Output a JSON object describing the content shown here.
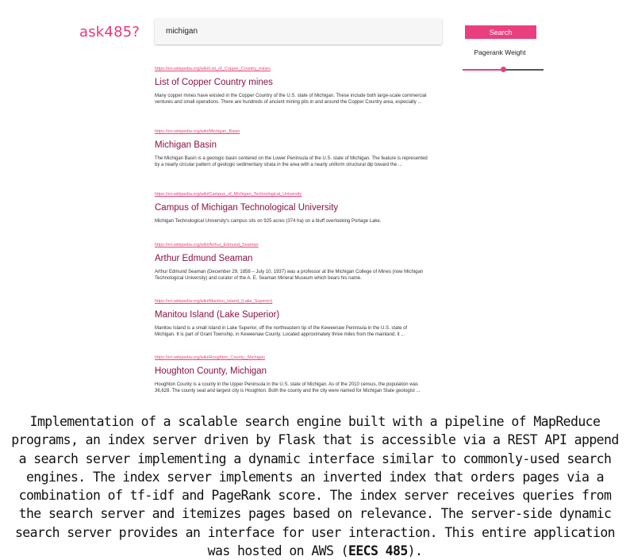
{
  "header": {
    "logo": "ask485?",
    "search_value": "michigan",
    "search_button": "Search",
    "pagerank_label": "Pagerank Weight",
    "pagerank_value": 0.5
  },
  "results": [
    {
      "url": "https://en.wikipedia.org/wiki/List_of_Copper_Country_mines",
      "title": "List of Copper Country mines",
      "summary": "Many copper mines have existed in the Copper Country of the U.S. state of Michigan. These include both large-scale commercial ventures and small operations. There are hundreds of ancient mining pits in and around the Copper Country area, especially ..."
    },
    {
      "url": "https://en.wikipedia.org/wiki/Michigan_Basin",
      "title": "Michigan Basin",
      "summary": "The Michigan Basin is a geologic basin centered on the Lower Peninsula of the U.S. state of Michigan. The feature is represented by a nearly circular pattern of geologic sedimentary strata in the area with a nearly uniform structural dip toward the ..."
    },
    {
      "url": "https://en.wikipedia.org/wiki/Campus_of_Michigan_Technological_University",
      "title": "Campus of Michigan Technological University",
      "summary": "Michigan Technological University's campus sits on 925 acres (374 ha) on a bluff overlooking Portage Lake."
    },
    {
      "url": "https://en.wikipedia.org/wiki/Arthur_Edmund_Seaman",
      "title": "Arthur Edmund Seaman",
      "summary": "Arthur Edmund Seaman (December 29, 1858 – July 10, 1937) was a professor at the Michigan College of Mines (now Michigan Technological University) and curator of the A. E. Seaman Mineral Museum which bears his name."
    },
    {
      "url": "https://en.wikipedia.org/wiki/Manitou_Island_(Lake_Superior)",
      "title": "Manitou Island (Lake Superior)",
      "summary": "Manitou Island is a small island in Lake Superior, off the northeastern tip of the Keweenaw Peninsula in the U.S. state of Michigan. It is part of Grant Township, in Keweenaw County. Located approximately three miles from the mainland, it ..."
    },
    {
      "url": "https://en.wikipedia.org/wiki/Houghton_County,_Michigan",
      "title": "Houghton County, Michigan",
      "summary": "Houghton County is a county in the Upper Peninsula in the U.S. state of Michigan. As of the 2010 census, the population was 36,628. The county seat and largest city is Houghton. Both the county and the city were named for Michigan State geologist ..."
    }
  ],
  "caption": {
    "text": "Implementation of a scalable search engine built with a pipeline of MapReduce programs, an index server driven by Flask that is accessible via a REST API append a search server implementing a dynamic interface similar to commonly-used search engines. The index server implements an inverted index that orders pages via a combination of tf-idf and PageRank score. The index server receives queries from the search server and itemizes pages based on relevance. The server-side dynamic search server provides an interface for user interaction. This entire application was hosted on AWS (",
    "bold": "EECS 485",
    "end": ")."
  },
  "colors": {
    "accent": "#ea3f7f",
    "title": "#8a1248"
  }
}
